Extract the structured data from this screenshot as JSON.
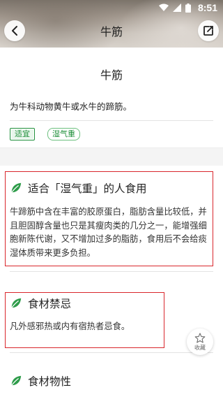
{
  "status_bar": {
    "time": "8:51",
    "icons": [
      "wifi-icon",
      "signal-icon",
      "battery-icon"
    ]
  },
  "nav": {
    "title": "牛筋",
    "back_icon": "chevron-left-icon",
    "edit_icon": "share-edit-icon"
  },
  "food": {
    "name": "牛筋",
    "description": "为牛科动物黄牛或水牛的蹄筋。"
  },
  "tags": [
    {
      "label": "适宜",
      "selected": true
    },
    {
      "label": "湿气重",
      "selected": false
    }
  ],
  "sections": [
    {
      "title": "适合「湿气重」的人食用",
      "body": "牛蹄筋中含在丰富的胶原蛋白，脂肪含量比较低，并且胆固醇含量也只是其瘦肉类的几分之一，能增强细胞新陈代谢，又不增加过多的脂肪，食用后不会给痰湿体质带来更多负担。"
    },
    {
      "title": "食材禁忌",
      "body": "凡外感邪热或内有宿热者忌食。"
    },
    {
      "title": "食材物性",
      "body": ""
    }
  ],
  "favorite": {
    "label": "收藏",
    "icon": "star-icon"
  },
  "colors": {
    "accent": "#1f8f3a",
    "highlight_box": "#d9262c"
  }
}
